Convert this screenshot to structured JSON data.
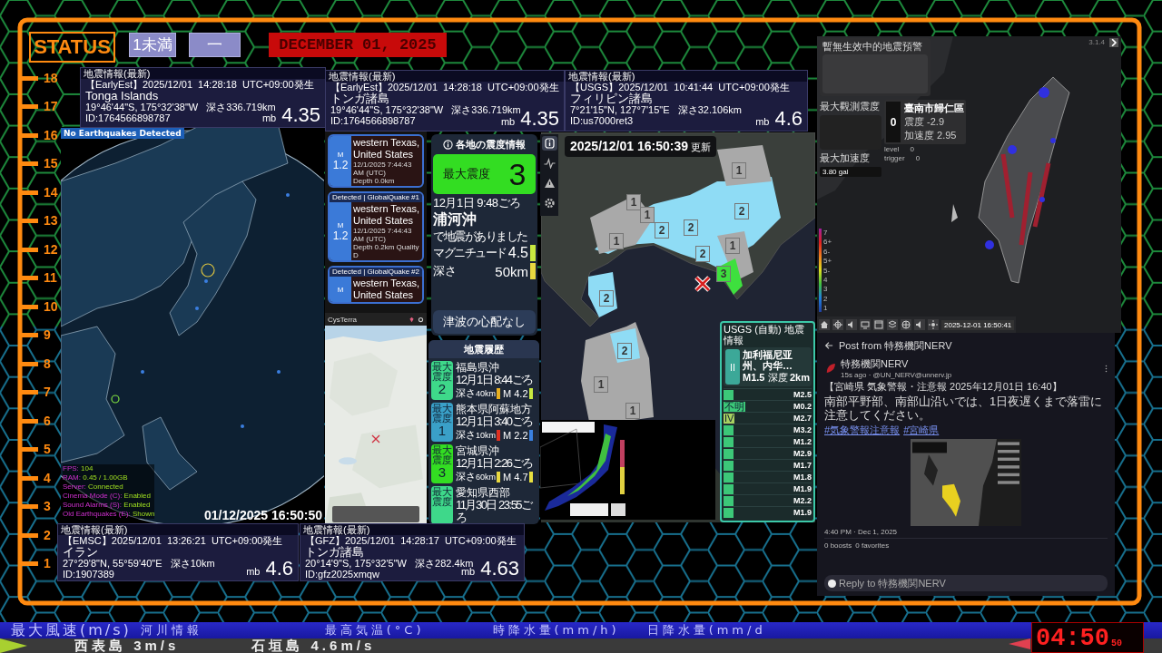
{
  "header": {
    "status": "STATUS",
    "badge_1": "1未満",
    "badge_2": "一",
    "date": "DECEMBER 01, 2025"
  },
  "ruler": [
    "18",
    "17",
    "16",
    "15",
    "14",
    "13",
    "12",
    "11",
    "10",
    "9",
    "8",
    "7",
    "6",
    "5",
    "4",
    "3",
    "2",
    "1"
  ],
  "quake_panels": [
    {
      "title": "地震情報(最新)",
      "source": "【EarlyEst】2025/12/01  14:28:18  UTC+09:00発生",
      "region": "Tonga Islands",
      "location": "19°46'44\"S, 175°32'38\"W   深さ336.719km",
      "id": "ID:1764566898787",
      "scale": "mb",
      "magnitude": "4.35"
    },
    {
      "title": "地震情報(最新)",
      "source": "【EarlyEst】2025/12/01  14:28:18  UTC+09:00発生",
      "region": "トンガ諸島",
      "location": "19°46'44\"S, 175°32'38\"W   深さ336.719km",
      "id": "ID:1764566898787",
      "scale": "mb",
      "magnitude": "4.35"
    },
    {
      "title": "地震情報(最新)",
      "source": "【USGS】2025/12/01  10:41:44  UTC+09:00発生",
      "region": "フィリピン諸島",
      "location": "7°21'15\"N, 127°7'15\"E   深さ32.106km",
      "id": "ID:us7000ret3",
      "scale": "mb",
      "magnitude": "4.6"
    },
    {
      "title": "地震情報(最新)",
      "source": "【EMSC】2025/12/01  13:26:21  UTC+09:00発生",
      "region": "イラン",
      "location": "27°29'8\"N, 55°59'40\"E   深さ10km",
      "id": "ID:1907389",
      "scale": "mb",
      "magnitude": "4.6"
    },
    {
      "title": "地震情報(最新)",
      "source": "【GFZ】2025/12/01  14:28:17  UTC+09:00発生",
      "region": "トンガ諸島",
      "location": "20°14'9\"S, 175°32'5\"W   深さ282.4km",
      "id": "ID:gfz2025xmqw",
      "scale": "mb",
      "magnitude": "4.63"
    }
  ],
  "globe": {
    "status": "No Earthquakes Detected",
    "stats": [
      {
        "label": "FPS:",
        "value": "104"
      },
      {
        "label": "RAM:",
        "value": "0.45 / 1.00GB"
      },
      {
        "label": "Server:",
        "value": "Connected"
      },
      {
        "label": "Cinema Mode (C):",
        "value": "Enabled"
      },
      {
        "label": "Sound Alarms (S):",
        "value": "Enabled"
      },
      {
        "label": "Old Earthquakes (E):",
        "value": "Shown"
      }
    ],
    "timestamp": "01/12/2025 16:50:50"
  },
  "globalquake": {
    "cards": [
      {
        "m_label": "M",
        "magnitude": "1.2",
        "lines": [
          "western Texas,",
          "United States"
        ],
        "details": [
          "12/1/2025 7:44:43 AM (UTC)",
          "Depth 0.0km"
        ]
      },
      {
        "header": "Detected | GlobalQuake",
        "number": "#1",
        "m_label": "M",
        "magnitude": "1.2",
        "lines": [
          "western Texas,",
          "United States"
        ],
        "details": [
          "12/1/2025 7:44:43 AM (UTC)",
          "Depth 0.2km   Quality D"
        ]
      },
      {
        "header": "Detected | GlobalQuake",
        "number": "#2",
        "m_label": "M",
        "lines": [
          "western Texas,",
          "United States"
        ]
      }
    ]
  },
  "cysterra": {
    "title": "CysTerra"
  },
  "intensity": {
    "title": "各地の震度情報",
    "max": {
      "label": "最大震度",
      "value": "3",
      "color": "#33dd22"
    },
    "time": "12月1日 9:48ごろ",
    "place": "浦河沖",
    "place_suffix": "で地震がありました",
    "magnitude": {
      "label": "マグニチュード",
      "value": "4.5",
      "color": "#c8e840"
    },
    "depth": {
      "label": "深さ",
      "value": "50km",
      "color": "#e8d840"
    },
    "tsunami": "津波の心配なし"
  },
  "side_tools": [
    {
      "kind": "info",
      "selected": true
    },
    {
      "kind": "wave",
      "selected": false
    },
    {
      "kind": "warning",
      "selected": false
    },
    {
      "kind": "settings",
      "selected": false
    }
  ],
  "hokkaido_map": {
    "updated": "2025/12/01 16:50:39",
    "updated_suffix": "更新",
    "markers": [
      {
        "value": "1",
        "color": "#a9a9a9"
      },
      {
        "value": "1",
        "color": "#a9a9a9"
      },
      {
        "value": "1",
        "color": "#a9a9a9"
      },
      {
        "value": "2",
        "color": "#8fdcf5"
      },
      {
        "value": "2",
        "color": "#8fdcf5"
      },
      {
        "value": "2",
        "color": "#8fdcf5"
      },
      {
        "value": "1",
        "color": "#a9a9a9"
      },
      {
        "value": "1",
        "color": "#a9a9a9"
      },
      {
        "value": "2",
        "color": "#8fdcf5"
      },
      {
        "value": "3",
        "color": "#3ee03e"
      },
      {
        "value": "2",
        "color": "#8fdcf5"
      },
      {
        "value": "2",
        "color": "#8fdcf5"
      },
      {
        "value": "1",
        "color": "#a9a9a9"
      },
      {
        "value": "1",
        "color": "#a9a9a9"
      }
    ]
  },
  "history": {
    "title": "地震履歴",
    "items": [
      {
        "badge_label": "最大震度",
        "intensity": "2",
        "color": "#3ed88a",
        "place": "福島県沖",
        "time": "12月1日 8:44ごろ",
        "depth_label": "深さ",
        "depth": {
          "value": "40km",
          "color": "#e8b020"
        },
        "magnitude": {
          "value": "M 4.2",
          "color": "#c8e840"
        }
      },
      {
        "badge_label": "最大震度",
        "intensity": "1",
        "color": "#3aa0c8",
        "place": "熊本県阿蘇地方",
        "time": "12月1日 3:40ごろ",
        "depth_label": "深さ",
        "depth": {
          "value": "10km",
          "color": "#e03020"
        },
        "magnitude": {
          "value": "M 2.2",
          "color": "#3a80e0"
        }
      },
      {
        "badge_label": "最大震度",
        "intensity": "3",
        "color": "#33dd22",
        "place": "宮城県沖",
        "time": "12月1日 2:26ごろ",
        "depth_label": "深さ",
        "depth": {
          "value": "60km",
          "color": "#e8d840"
        },
        "magnitude": {
          "value": "M 4.7",
          "color": "#e8e040"
        }
      },
      {
        "badge_label": "最大震度",
        "color": "#3ed88a",
        "place": "愛知県西部",
        "time": "11月30日 23:55ごろ"
      }
    ]
  },
  "usgs": {
    "title": "USGS (自動) 地震情報",
    "headline": {
      "intensity": "II",
      "region": "加利福尼亚州、内华…",
      "magnitude": "M1.5",
      "depth_label": "深度",
      "depth": "2km"
    },
    "items": [
      {
        "magnitude": "M2.5",
        "color": "#3cc878"
      },
      {
        "badge": "不明",
        "magnitude": "M0.2",
        "color": "#3cc878"
      },
      {
        "badge": "IV",
        "magnitude": "M2.7",
        "color": "#a8d060"
      },
      {
        "magnitude": "M3.2",
        "color": "#3cc878"
      },
      {
        "magnitude": "M1.2",
        "color": "#3cc878"
      },
      {
        "magnitude": "M2.9",
        "color": "#3cc878"
      },
      {
        "magnitude": "M1.7",
        "color": "#3cc878"
      },
      {
        "magnitude": "M1.8",
        "color": "#3cc878"
      },
      {
        "magnitude": "M1.9",
        "color": "#3cc878"
      },
      {
        "magnitude": "M2.2",
        "color": "#3cc878"
      },
      {
        "magnitude": "M1.9",
        "color": "#3cc878"
      }
    ]
  },
  "taiwan": {
    "warning_title": "暫無生效中的地震預警",
    "max_intensity_label": "最大觀測震度",
    "station_value": "0",
    "station": "臺南市歸仁區",
    "station_intensity": "震度 -2.9",
    "station_accel": "加速度 2.95",
    "counters": [
      {
        "label": "level",
        "value": "0"
      },
      {
        "label": "trigger",
        "value": "0"
      }
    ],
    "max_accel_label": "最大加速度",
    "max_accel": "3.80 gal",
    "version": "3.1.4",
    "scale": [
      "7",
      "6+",
      "6-",
      "5+",
      "5-",
      "4",
      "3",
      "2",
      "1"
    ],
    "timestamp": "2025-12-01 16:50:41"
  },
  "post": {
    "header": "Post from 特務機関NERV",
    "author": "特務機関NERV",
    "meta": "15s ago · @UN_NERV@unnerv.jp",
    "title": "【宮崎県 気象警報・注意報 2025年12月01日 16:40】",
    "body": "南部平野部、南部山沿いでは、1日夜遅くまで落雷に注意してください。",
    "hashtags": [
      "#気象警報注意報",
      "#宮崎県"
    ],
    "timestamp": "4:40 PM · Dec 1, 2025",
    "boosts": "0 boosts",
    "favorites": "0 favorites",
    "reply_placeholder": "Reply to 特務機関NERV"
  },
  "ticker": {
    "headings": [
      {
        "text": "最大風速(m/s)",
        "kind": "main"
      },
      {
        "text": "河川情報",
        "kind": "sub"
      },
      {
        "text": "最高気温(°C)",
        "kind": "sub"
      },
      {
        "text": "時降水量(mm/h)",
        "kind": "sub"
      },
      {
        "text": "日降水量(mm/d",
        "kind": "sub"
      }
    ],
    "values": [
      "西表島 3m/s",
      "石垣島 4.6m/s"
    ],
    "clock": "04:50",
    "clock_seconds": "50"
  }
}
